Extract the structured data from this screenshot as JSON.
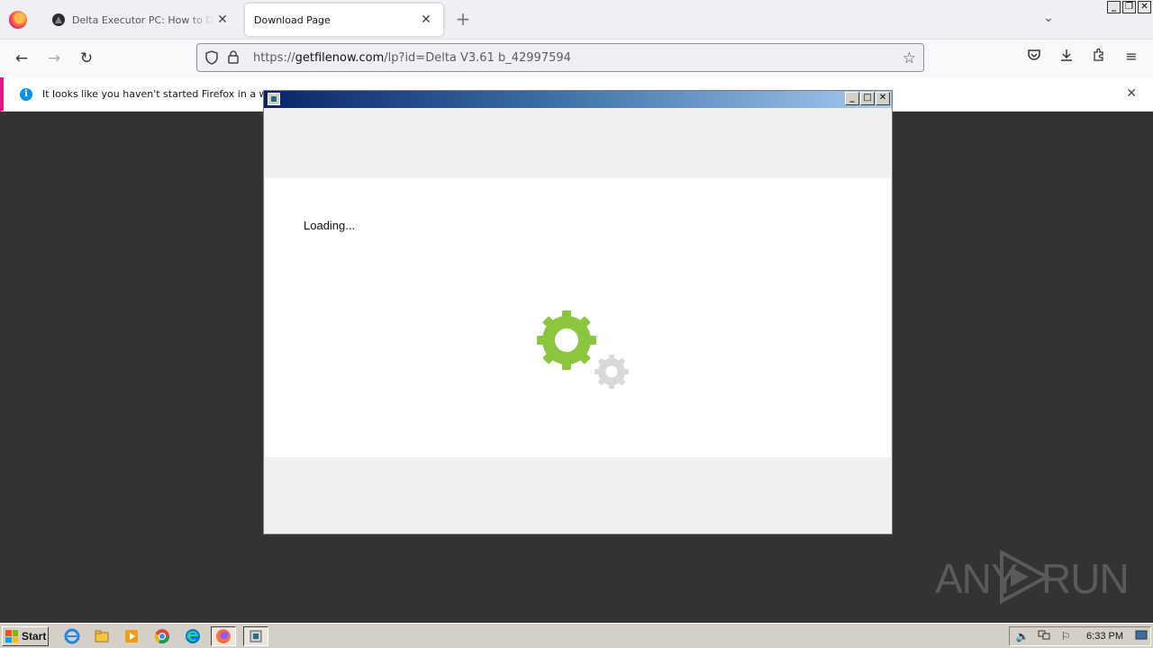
{
  "browser": {
    "tabs": [
      {
        "title": "Delta Executor PC: How to Download",
        "active": false
      },
      {
        "title": "Download Page",
        "active": true
      }
    ],
    "url": {
      "prefix": "https://",
      "domain": "getfilenow.com",
      "path": "/lp?id=Delta V3.61 b_42997594"
    },
    "notification": "It looks like you haven't started Firefox in a while. D"
  },
  "dialog": {
    "loading_text": "Loading..."
  },
  "watermark": {
    "text_left": "ANY",
    "text_right": "RUN"
  },
  "taskbar": {
    "start_label": "Start",
    "clock": "6:33 PM",
    "apps": [
      "ie-icon",
      "explorer-icon",
      "media-player-icon",
      "chrome-icon",
      "edge-icon",
      "firefox-icon",
      "installer-icon"
    ]
  },
  "colors": {
    "gear_primary": "#8cc63f",
    "gear_secondary": "#d9d9d9",
    "desktop_bg": "#333333",
    "notify_accent": "#e31587"
  }
}
